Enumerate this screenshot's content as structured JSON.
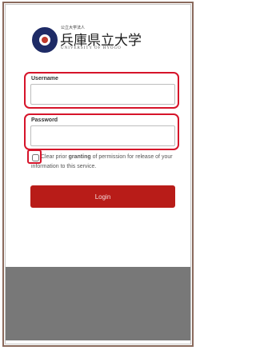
{
  "logo": {
    "small_text": "公立大学法人",
    "name": "兵庫県立大学",
    "subtitle": "UNIVERSITY OF HYOGO"
  },
  "form": {
    "username_label": "Username",
    "username_value": "",
    "password_label": "Password",
    "password_value": "",
    "consent_text_pre": "Clear prior ",
    "consent_text_bold": "granting",
    "consent_text_post": " of permission for release of your information to this service.",
    "consent_checked": false,
    "login_label": "Login"
  },
  "colors": {
    "login_button": "#b81c18",
    "highlight_box": "#d6142a",
    "footer": "#787878"
  }
}
